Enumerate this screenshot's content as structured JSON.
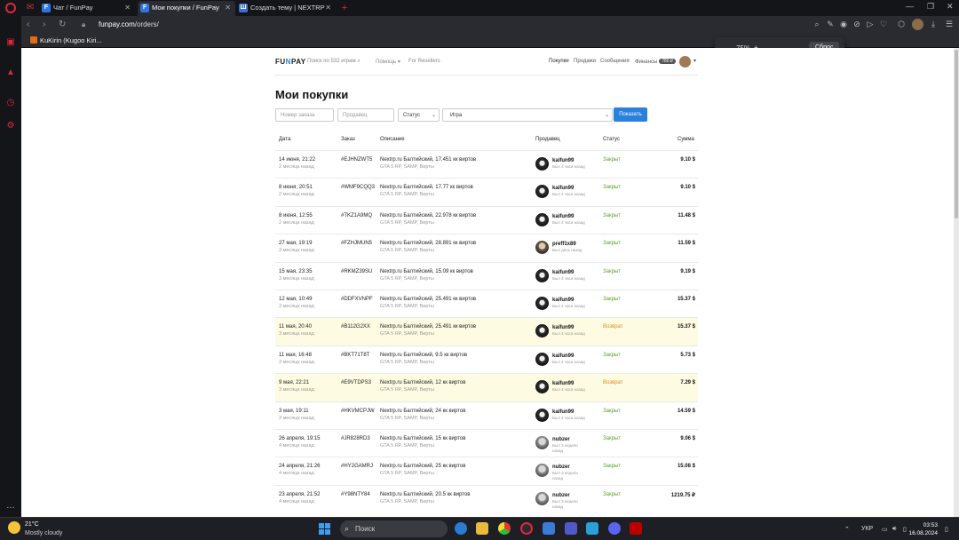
{
  "browser": {
    "tabs": [
      {
        "label": "Чат / FunPay",
        "favicon": "F",
        "active": false
      },
      {
        "label": "Мои покупки / FunPay",
        "favicon": "F",
        "active": true
      },
      {
        "label": "Создать тему | NEXTRP",
        "favicon": "Ш",
        "active": false
      }
    ],
    "url_host": "funpay.com",
    "url_path": "/orders/",
    "bookmark": "KuKirin (Kugoo Kiri...",
    "zoom": {
      "minus": "−",
      "value": "75%",
      "plus": "+",
      "reset": "Сброс"
    }
  },
  "header": {
    "logo_a": "FU",
    "logo_b": "N",
    "logo_c": "PAY",
    "search_placeholder": "Поиск по 532 играм",
    "help": "Помощь",
    "resellers": "For Resellers",
    "nav": {
      "purchases": "Покупки",
      "sales": "Продажи",
      "messages": "Сообщения",
      "finances": "Финансы",
      "balance": "780 ₽"
    }
  },
  "page": {
    "title": "Мои покупки"
  },
  "filters": {
    "order_placeholder": "Номер заказа",
    "seller_placeholder": "Продавец",
    "status": "Статус",
    "game": "Игра",
    "show": "Показать"
  },
  "table": {
    "headers": {
      "date": "Дата",
      "order": "Заказ",
      "desc": "Описание",
      "seller": "Продавец",
      "status": "Статус",
      "sum": "Сумма"
    },
    "rows": [
      {
        "date": "14 июня, 21:22",
        "ago": "2 месяца назад",
        "order": "#EJHNZWT5",
        "desc": "Nextrp.ru Балтийский, 17.451 кк виртов",
        "sub": "GTA 5 RP, SAMP, Вирты",
        "seller": "kaifun99",
        "seen": "Был 4 часа назад",
        "seen2": "",
        "status": "Закрыт",
        "sum": "9.10 $",
        "hl": false
      },
      {
        "date": "8 июня, 20:51",
        "ago": "2 месяца назад",
        "order": "#WMF9CQQ3",
        "desc": "Nextrp.ru Балтийский, 17.77 кк виртов",
        "sub": "GTA 5 RP, SAMP, Вирты",
        "seller": "kaifun99",
        "seen": "Был 4 часа назад",
        "seen2": "",
        "status": "Закрыт",
        "sum": "9.10 $",
        "hl": false
      },
      {
        "date": "8 июня, 12:55",
        "ago": "2 месяца назад",
        "order": "#TKZ1A9MQ",
        "desc": "Nextrp.ru Балтийский, 22.978 кк виртов",
        "sub": "GTA 5 RP, SAMP, Вирты",
        "seller": "kaifun99",
        "seen": "Был 4 часа назад",
        "seen2": "",
        "status": "Закрыт",
        "sum": "11.48 $",
        "hl": false
      },
      {
        "date": "27 мая, 19:19",
        "ago": "3 месяца назад",
        "order": "#FZHJMUN5",
        "desc": "Nextrp.ru Балтийский, 28.891 кк виртов",
        "sub": "GTA 5 RP, SAMP, Вирты",
        "seller": "preff1x89",
        "seen": "Был день назад",
        "seen2": "",
        "status": "Закрыт",
        "sum": "11.59 $",
        "hl": false
      },
      {
        "date": "15 мая, 23:35",
        "ago": "3 месяца назад",
        "order": "#RKMZ39SU",
        "desc": "Nextrp.ru Балтийский, 15.09 кк виртов",
        "sub": "GTA 5 RP, SAMP, Вирты",
        "seller": "kaifun99",
        "seen": "Был 4 часа назад",
        "seen2": "",
        "status": "Закрыт",
        "sum": "9.19 $",
        "hl": false
      },
      {
        "date": "12 мая, 10:49",
        "ago": "3 месяца назад",
        "order": "#DDFXVNPF",
        "desc": "Nextrp.ru Балтийский, 25.491 кк виртов",
        "sub": "GTA 5 RP, SAMP, Вирты",
        "seller": "kaifun99",
        "seen": "Был 4 часа назад",
        "seen2": "",
        "status": "Закрыт",
        "sum": "15.37 $",
        "hl": false
      },
      {
        "date": "11 мая, 20:40",
        "ago": "3 месяца назад",
        "order": "#B112G2XX",
        "desc": "Nextrp.ru Балтийский, 25.491 кк виртов",
        "sub": "GTA 5 RP, SAMP, Вирты",
        "seller": "kaifun99",
        "seen": "Был 4 часа назад",
        "seen2": "",
        "status": "Возврат",
        "sum": "15.37 $",
        "hl": true
      },
      {
        "date": "11 мая, 16:48",
        "ago": "3 месяца назад",
        "order": "#BKT71T8T",
        "desc": "Nextrp.ru Балтийский, 9.5 кк виртов",
        "sub": "GTA 5 RP, SAMP, Вирты",
        "seller": "kaifun99",
        "seen": "Был 4 часа назад",
        "seen2": "",
        "status": "Закрыт",
        "sum": "5.73 $",
        "hl": false
      },
      {
        "date": "9 мая, 22:21",
        "ago": "3 месяца назад",
        "order": "#E9VTDPS3",
        "desc": "Nextrp.ru Балтийский, 12 кк виртов",
        "sub": "GTA 5 RP, SAMP, Вирты",
        "seller": "kaifun99",
        "seen": "Был 4 часа назад",
        "seen2": "",
        "status": "Возврат",
        "sum": "7.29 $",
        "hl": true
      },
      {
        "date": "3 мая, 19:11",
        "ago": "3 месяца назад",
        "order": "#HKVMCPJW",
        "desc": "Nextrp.ru Балтийский, 24 кк виртов",
        "sub": "GTA 5 RP, SAMP, Вирты",
        "seller": "kaifun99",
        "seen": "Был 4 часа назад",
        "seen2": "",
        "status": "Закрыт",
        "sum": "14.59 $",
        "hl": false
      },
      {
        "date": "26 апреля, 19:15",
        "ago": "4 месяца назад",
        "order": "#JR828RD3",
        "desc": "Nextrp.ru Балтийский, 15 кк виртов",
        "sub": "GTA 5 RP, SAMP, Вирты",
        "seller": "nubzer",
        "seen": "Был 3 недели",
        "seen2": "назад",
        "status": "Закрыт",
        "sum": "9.06 $",
        "hl": false
      },
      {
        "date": "24 апреля, 21:26",
        "ago": "4 месяца назад",
        "order": "#HY2GAMRJ",
        "desc": "Nextrp.ru Балтийский, 25 кк виртов",
        "sub": "GTA 5 RP, SAMP, Вирты",
        "seller": "nubzer",
        "seen": "Был 3 недели",
        "seen2": "назад",
        "status": "Закрыт",
        "sum": "15.08 $",
        "hl": false
      },
      {
        "date": "23 апреля, 21:52",
        "ago": "4 месяца назад",
        "order": "#Y98NTY84",
        "desc": "Nextrp.ru Балтийский, 20.5 кк виртов",
        "sub": "GTA 5 RP, SAMP, Вирты",
        "seller": "nubzer",
        "seen": "Был 3 недели",
        "seen2": "назад",
        "status": "Закрыт",
        "sum": "1219.75 ₽",
        "hl": false
      }
    ]
  },
  "taskbar": {
    "temp": "21°C",
    "weather": "Mostly cloudy",
    "search": "Поиск",
    "lang": "УКР",
    "time": "03:53",
    "date": "16.08.2024"
  }
}
